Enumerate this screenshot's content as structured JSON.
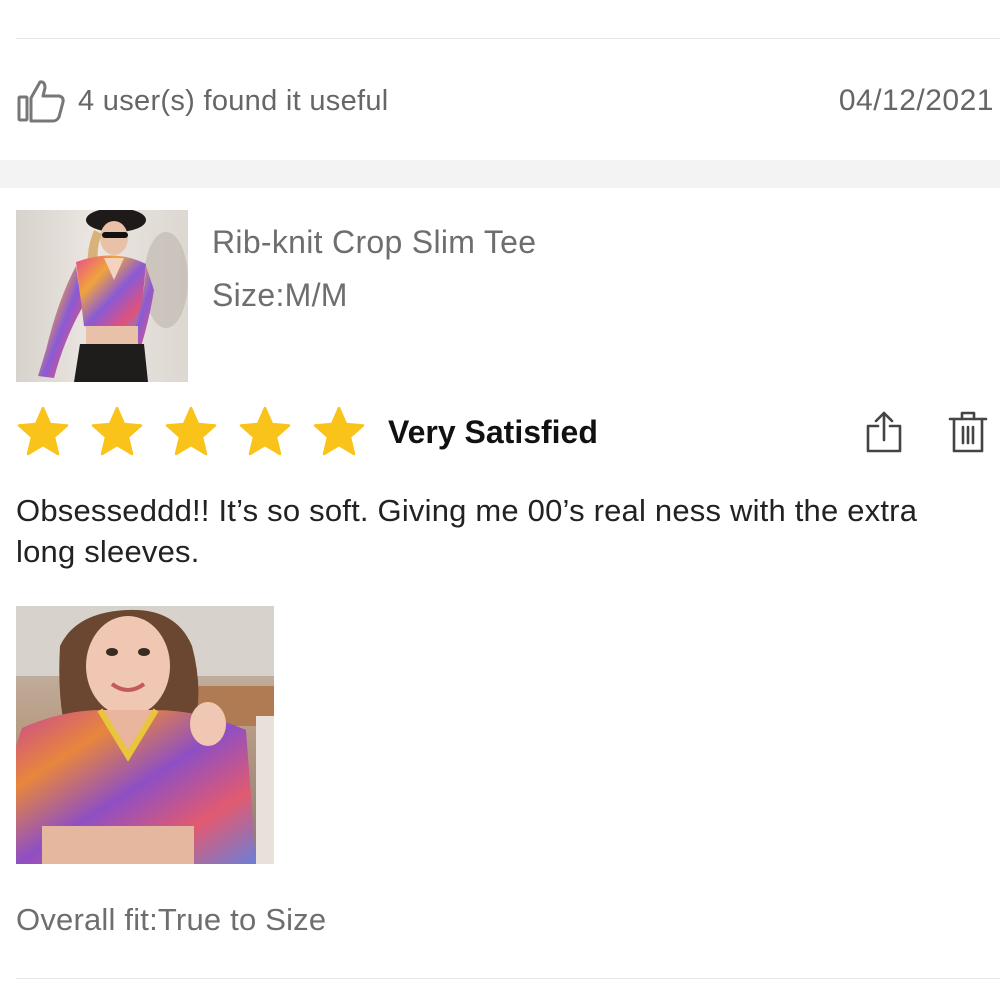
{
  "review": {
    "useful_text": "4 user(s) found it useful",
    "date": "04/12/2021",
    "product": {
      "name": "Rib-knit Crop Slim Tee",
      "size": "Size:M/M"
    },
    "rating": {
      "stars": 5,
      "max_stars": 5,
      "label": "Very Satisfied",
      "star_color": "#f9c31a"
    },
    "body": "Obsesseddd!! It’s so soft. Giving me 00’s real ness with the extra long sleeves.",
    "overall_fit": "Overall fit:True to Size"
  },
  "icons": {
    "useful": "thumbs-up-icon",
    "share": "share-icon",
    "delete": "trash-icon"
  }
}
